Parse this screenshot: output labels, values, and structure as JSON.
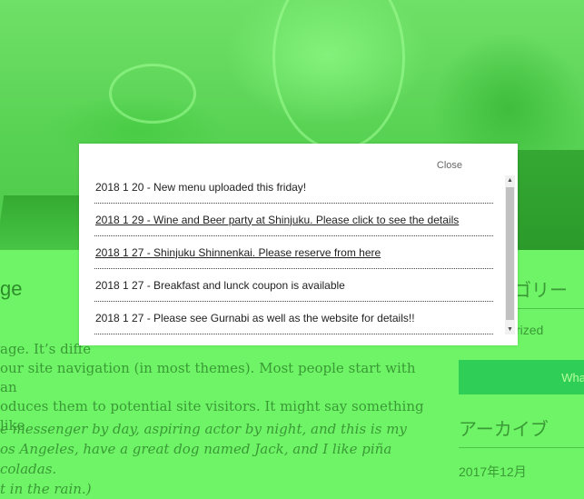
{
  "modal": {
    "close_label": "Close",
    "items": [
      {
        "text": "2018 1 20 - New menu uploaded this friday!",
        "link": false
      },
      {
        "text": "2018 1 29 - Wine and Beer party at Shinjuku. Please click to see the details",
        "link": true
      },
      {
        "text": "2018 1 27 - Shinjuku Shinnenkai. Please reserve from here",
        "link": true
      },
      {
        "text": "2018 1 27 - Breakfast and lunck coupon is available",
        "link": false
      },
      {
        "text": "2018 1 27 - Please see Gurnabi as well as the website for details!!",
        "link": false
      }
    ],
    "scroll_up_icon": "▲",
    "scroll_down_icon": "▼"
  },
  "page": {
    "post_title": "ge",
    "body_lines": [
      "age. It’s diffe",
      "our site navigation (in most themes). Most people start with an",
      "oduces them to potential site visitors. It might say something like"
    ],
    "quote_lines": [
      "e messenger by day, aspiring actor by night, and this is my",
      "os Angeles, have a great dog named Jack, and I like piña coladas.",
      "t in the rain.)"
    ]
  },
  "sidebar": {
    "category_title": "ゴリー",
    "category_item": "rized",
    "button_label": "Wha",
    "archive_title": "アーカイブ",
    "archive_item": "2017年12月"
  },
  "colors": {
    "page_tint": "#6ef466",
    "button": "#2fcf57"
  }
}
